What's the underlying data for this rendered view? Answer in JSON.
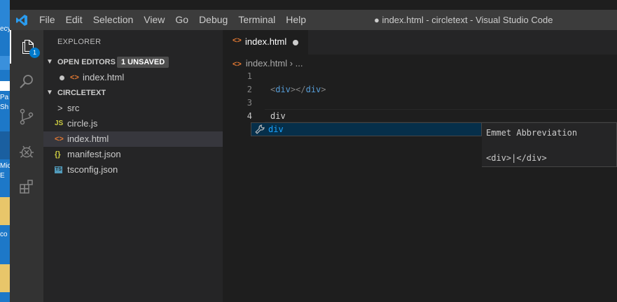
{
  "desktop": {
    "fragments": [
      "ecy",
      "Pa",
      "Sh",
      "Mic",
      "E",
      "co"
    ]
  },
  "titlebar": {
    "menu": [
      "File",
      "Edit",
      "Selection",
      "View",
      "Go",
      "Debug",
      "Terminal",
      "Help"
    ],
    "window_title": "● index.html - circletext - Visual Studio Code"
  },
  "activitybar": {
    "icons": [
      "explorer-icon",
      "search-icon",
      "source-control-icon",
      "debug-icon",
      "extensions-icon"
    ],
    "badge": "1"
  },
  "sidebar": {
    "header": "EXPLORER",
    "open_editors": {
      "title": "OPEN EDITORS",
      "badge": "1 UNSAVED",
      "items": [
        {
          "icon": "<>",
          "label": "index.html"
        }
      ]
    },
    "folder": {
      "title": "CIRCLETEXT",
      "items": [
        {
          "icon": ">",
          "label": "src"
        },
        {
          "icon": "JS",
          "label": "circle.js"
        },
        {
          "icon": "<>",
          "label": "index.html"
        },
        {
          "icon": "{}",
          "label": "manifest.json"
        },
        {
          "icon": "TS",
          "label": "tsconfig.json"
        }
      ]
    }
  },
  "editor": {
    "tab": {
      "icon": "<>",
      "label": "index.html"
    },
    "breadcrumb": {
      "icon": "<>",
      "file": "index.html",
      "rest": " › ..."
    },
    "lines": [
      {
        "num": "1",
        "tag_open": "",
        "tag_name": "",
        "tag_mid": "",
        "tag_name2": "",
        "tag_close": "",
        "text": ""
      },
      {
        "num": "2",
        "tag_open": "<",
        "tag_name": "div",
        "tag_mid": "></",
        "tag_name2": "div",
        "tag_close": ">",
        "text": ""
      },
      {
        "num": "3",
        "tag_open": "",
        "tag_name": "",
        "tag_mid": "",
        "tag_name2": "",
        "tag_close": "",
        "text": ""
      },
      {
        "num": "4",
        "tag_open": "",
        "tag_name": "",
        "tag_mid": "",
        "tag_name2": "",
        "tag_close": "",
        "text": "div"
      }
    ],
    "suggestion": {
      "icon": "wrench-icon",
      "label": "div"
    },
    "details": {
      "title": "Emmet Abbreviation",
      "preview": "<div>|</div>"
    }
  }
}
